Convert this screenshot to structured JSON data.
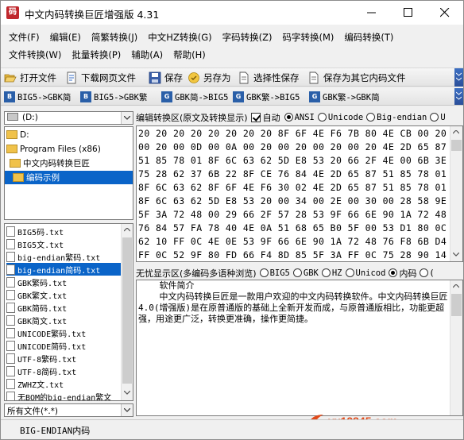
{
  "window": {
    "title": "中文内码转换巨匠增强版  4.31",
    "app_icon_text": "码"
  },
  "menu": {
    "row1": [
      "文件(F)",
      "编辑(E)",
      "简繁转换(J)",
      "中文HZ转换(G)",
      "字码转换(Z)",
      "码字转换(M)",
      "编码转换(T)"
    ],
    "row2": [
      "文件转换(W)",
      "批量转换(P)",
      "辅助(A)",
      "帮助(H)"
    ]
  },
  "toolbar": {
    "open_file": "打开文件",
    "download_page": "下载网页文件",
    "save": "保存",
    "save_as": "另存为",
    "selective_save": "选择性保存",
    "save_as_other_encoding": "保存为其它内码文件"
  },
  "toolbar2": {
    "buttons": [
      "BIG5->GBK简",
      "BIG5->GBK繁",
      "GBK简->BIG5",
      "GBK繁->BIG5",
      "GBK繁->GBK简"
    ]
  },
  "left_panel": {
    "drive": "(D:)",
    "tree": [
      "D:",
      "Program Files (x86)",
      "中文内码转换巨匠",
      "编码示例"
    ],
    "selected_tree_index": 3,
    "files": [
      "BIG5码.txt",
      "BIG5文.txt",
      "big-endian繁码.txt",
      "big-endian简码.txt",
      "GBK繁码.txt",
      "GBK繁文.txt",
      "GBK简码.txt",
      "GBK简文.txt",
      "UNICODE繁码.txt",
      "UNICODE简码.txt",
      "UTF-8繁码.txt",
      "UTF-8简码.txt",
      "ZWHZ文.txt",
      "无BOM的big-endian繁文"
    ],
    "selected_file_index": 3,
    "filter": "所有文件(*.*)"
  },
  "editor": {
    "label": "编辑转换区(原文及转换显示)",
    "auto_label": "自动",
    "auto_checked": true,
    "encodings": [
      "ANSI",
      "Unicode",
      "Big-endian",
      "U"
    ],
    "selected_encoding": "ANSI",
    "hex_lines": [
      "20 20 20 20 20 20 20 20 8F 6F 4E F6 7B 80 4E CB 00 20",
      "00 20 00 0D 00 0A 00 20 00 20 00 20 00 20 4E 2D 65 87",
      "51 85 78 01 8F 6C 63 62 5D E8 53 20 66 2F 4E 00 6B 3E",
      "75 28 62 37 6B 22 8F CE 76 84 4E 2D 65 87 51 85 78 01",
      "8F 6C 63 62 8F 6F 4E F6 30 02 4E 2D 65 87 51 85 78 01",
      "8F 6C 63 62 5D E8 53 20 00 34 00 2E 00 30 00 28 58 9E",
      "5F 3A 72 48 00 29 66 2F 57 28 53 9F 66 6E 90 1A 72 48",
      "76 84 57 FA 78 40 4E 0A 51 68 65 B0 5F 00 53 D1 80 0C",
      "62 10 FF 0C 4E 0E 53 9F 66 6E 90 1A 72 48 76 F8 6B D4",
      "FF 0C 52 9F 80 FD 66 F4 8D 85 5F 3A FF 0C 75 28 90 14"
    ]
  },
  "viewer": {
    "label": "无忧显示区(多编码多语种浏览)",
    "encodings": [
      "BIG5",
      "GBK",
      "HZ",
      "Unicod",
      "内码",
      "("
    ],
    "selected_encoding": "内码",
    "heading": "    软件简介",
    "body": "    中文内码转换巨匠是一款用户欢迎的中文内码转换软件。中文内码转换巨匠4.0(增强版)是在原普通版的基础上全新开发而成，与原普通版相比，功能更超强，用途更广泛，转换更准确，操作更简捷。"
  },
  "watermark": "yx12345.com",
  "status": {
    "text": "BIG-ENDIAN内码"
  }
}
